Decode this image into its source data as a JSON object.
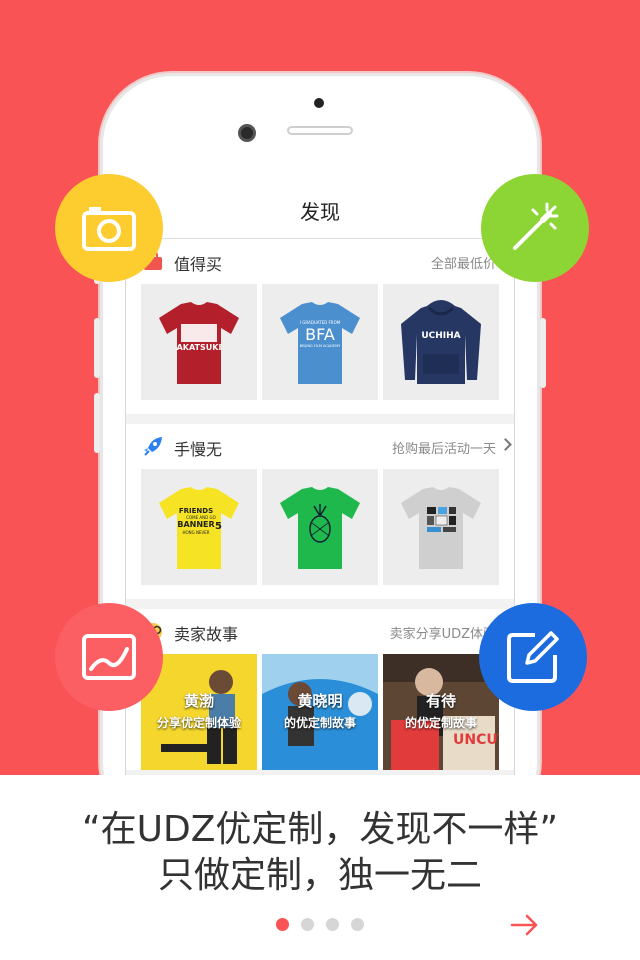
{
  "nav": {
    "title": "发现"
  },
  "sections": {
    "worth_buying": {
      "title": "值得买",
      "more": "全部最低价"
    },
    "hand_slow": {
      "title": "手慢无",
      "more": "抢购最后活动一天"
    },
    "seller_story": {
      "title": "卖家故事",
      "more": "卖家分享UDZ体验"
    }
  },
  "products": {
    "p1": {
      "print": "AKATSUKI"
    },
    "p2": {
      "print": "BFA",
      "line1": "I GRADUATED FROM",
      "line2": "BEIJING FILM ACADEMY"
    },
    "p3": {
      "print": "UCHIHA"
    },
    "p4": {
      "print1": "FRIENDS",
      "print2": "COME AND GO",
      "print3": "BANNER",
      "print4": "HONG NEVER",
      "num": "5"
    }
  },
  "stories": [
    {
      "line1": "黄渤",
      "line2": "分享优定制体验"
    },
    {
      "line1": "黄晓明",
      "line2": "的优定制故事"
    },
    {
      "line1": "有待",
      "line2": "的优定制故事",
      "magazine": "UNCUT"
    }
  ],
  "tagline": {
    "line1": "“在UDZ优定制，发现不一样”",
    "line2": "只做定制，独一无二"
  },
  "pager": {
    "count": 4,
    "active": 0
  },
  "colors": {
    "brand_red": "#fa5356",
    "camera_yellow": "#fdcc2f",
    "magic_green": "#8dd435",
    "chart_pink": "#fb5f64",
    "edit_blue": "#1c6ce0"
  },
  "icons": [
    "camera-icon",
    "magic-wand-icon",
    "chart-icon",
    "edit-icon",
    "arrow-right-icon"
  ]
}
